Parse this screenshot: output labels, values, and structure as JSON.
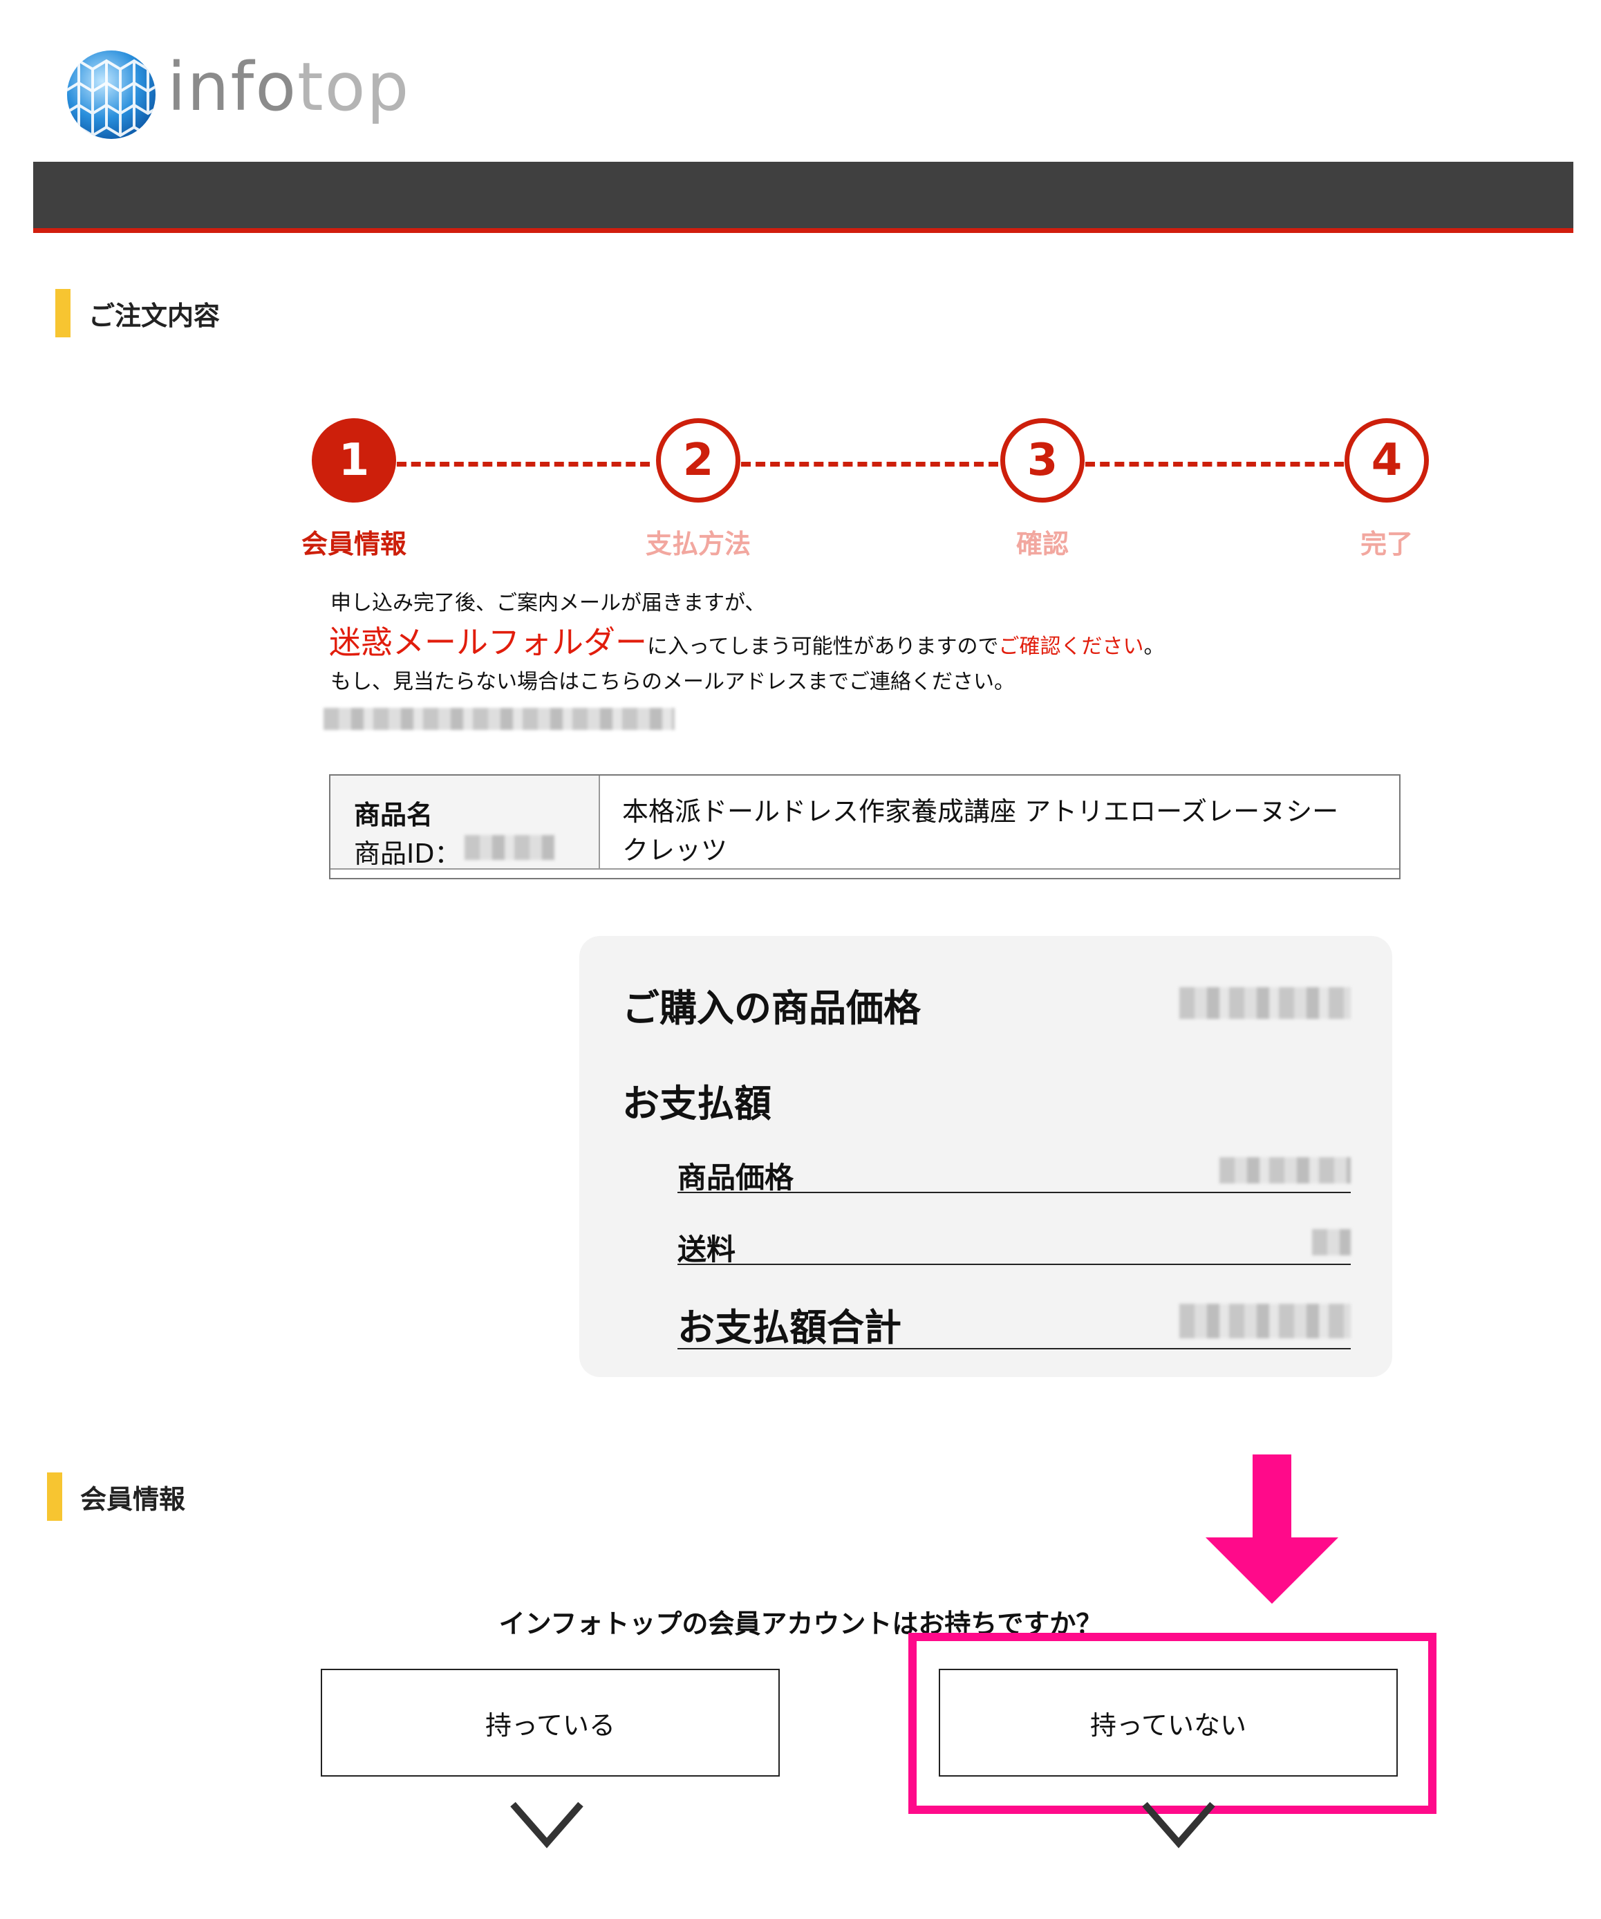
{
  "brand": {
    "logo_text_a": "info",
    "logo_text_b": "top"
  },
  "order_section": {
    "title": "ご注文内容"
  },
  "stepper": {
    "steps": [
      {
        "number": "1",
        "label": "会員情報",
        "active": true
      },
      {
        "number": "2",
        "label": "支払方法",
        "active": false
      },
      {
        "number": "3",
        "label": "確認",
        "active": false
      },
      {
        "number": "4",
        "label": "完了",
        "active": false
      }
    ]
  },
  "notice": {
    "line1": "申し込み完了後、ご案内メールが届きますが、",
    "line2_red": "迷惑メールフォルダー",
    "line2_mid": "に入ってしまう可能性がありますので",
    "line2_red2": "ご確認ください",
    "line2_end": "。",
    "line3": "もし、見当たらない場合はこちらのメールアドレスまでご連絡ください。"
  },
  "product": {
    "name_label": "商品名",
    "id_label": "商品ID：",
    "name_line1": "本格派ドールドレス作家養成講座 アトリエローズレーヌシー",
    "name_line2": "クレッツ"
  },
  "price_card": {
    "purchase_price_label": "ご購入の商品価格",
    "payment_label": "お支払額",
    "item_price_label": "商品価格",
    "shipping_label": "送料",
    "total_label": "お支払額合計"
  },
  "member_section": {
    "title": "会員情報",
    "question": "インフォトップの会員アカウントはお持ちですか？",
    "has_account_label": "持っている",
    "no_account_label": "持っていない"
  },
  "colors": {
    "accent_red": "#cd1f0b",
    "highlight_pink": "#ff0a8a",
    "section_bar_yellow": "#f7c531",
    "navbar": "#404040"
  }
}
